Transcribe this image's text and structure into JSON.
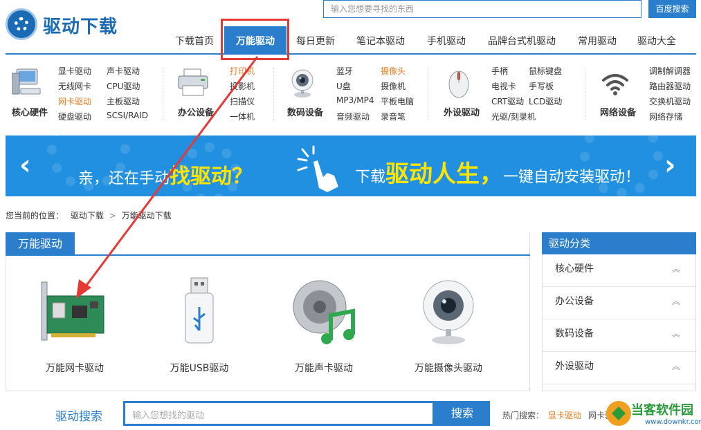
{
  "site": {
    "logo_text": "驱动下载"
  },
  "top_search": {
    "placeholder": "输入您想要寻找的东西",
    "button": "百度搜索"
  },
  "nav": {
    "items": [
      "下载首页",
      "万能驱动",
      "每日更新",
      "笔记本驱动",
      "手机驱动",
      "品牌台式机驱动",
      "常用驱动",
      "驱动大全"
    ],
    "active": "万能驱动"
  },
  "categories": [
    {
      "name": "核心硬件",
      "icon": "computer-icon",
      "links": [
        "显卡驱动",
        "声卡驱动",
        "无线网卡",
        "CPU驱动",
        "网卡驱动",
        "主板驱动",
        "硬盘驱动",
        "SCSI/RAID"
      ],
      "highlight": [
        "网卡驱动"
      ]
    },
    {
      "name": "办公设备",
      "icon": "printer-icon",
      "links": [
        "打印机",
        "投影机",
        "扫描仪",
        "一体机"
      ],
      "highlight": [
        "打印机"
      ]
    },
    {
      "name": "数码设备",
      "icon": "webcam-icon",
      "links": [
        "蓝牙",
        "摄像头",
        "U盘",
        "摄像机",
        "MP3/MP4",
        "平板电脑",
        "音频驱动",
        "录音笔"
      ],
      "highlight": [
        "摄像头"
      ]
    },
    {
      "name": "外设驱动",
      "icon": "mouse-icon",
      "links": [
        "手柄",
        "鼠标键盘",
        "电视卡",
        "手写板",
        "CRT驱动",
        "LCD驱动",
        "光驱/刻录机"
      ],
      "highlight": []
    },
    {
      "name": "网络设备",
      "icon": "wifi-icon",
      "links": [
        "调制解调器",
        "路由器驱动",
        "交换机驱动",
        "网络存储"
      ],
      "highlight": []
    }
  ],
  "banner": {
    "prefix": "亲，还在手动",
    "emph1": "找驱动？",
    "mid": "下载",
    "emph2": "驱动人生，",
    "suffix": "一键自动安装驱动！"
  },
  "breadcrumb": {
    "label": "您当前的位置：",
    "path1": "驱动下载",
    "sep": ">",
    "path2": "万能驱动下载"
  },
  "main": {
    "title": "万能驱动",
    "products": [
      {
        "label": "万能网卡驱动",
        "icon": "network-card-icon"
      },
      {
        "label": "万能USB驱动",
        "icon": "usb-drive-icon"
      },
      {
        "label": "万能声卡驱动",
        "icon": "speaker-music-icon"
      },
      {
        "label": "万能摄像头驱动",
        "icon": "webcam-icon"
      }
    ]
  },
  "sidebar": {
    "title": "驱动分类",
    "items": [
      "核心硬件",
      "办公设备",
      "数码设备",
      "外设驱动"
    ]
  },
  "bottom_search": {
    "label": "驱动搜索",
    "placeholder": "输入您想找的驱动",
    "button": "搜索",
    "hot_label": "热门搜索：",
    "hot": [
      "显卡驱动",
      "网卡驱动"
    ]
  },
  "watermark": {
    "name": "当客软件园",
    "url": "www.downkr.com"
  },
  "colors": {
    "brand_blue": "#2a7ecb",
    "highlight_red": "#e53935",
    "link_orange": "#e67e22",
    "banner_blue": "#2290e0",
    "banner_yellow": "#ffe400"
  }
}
